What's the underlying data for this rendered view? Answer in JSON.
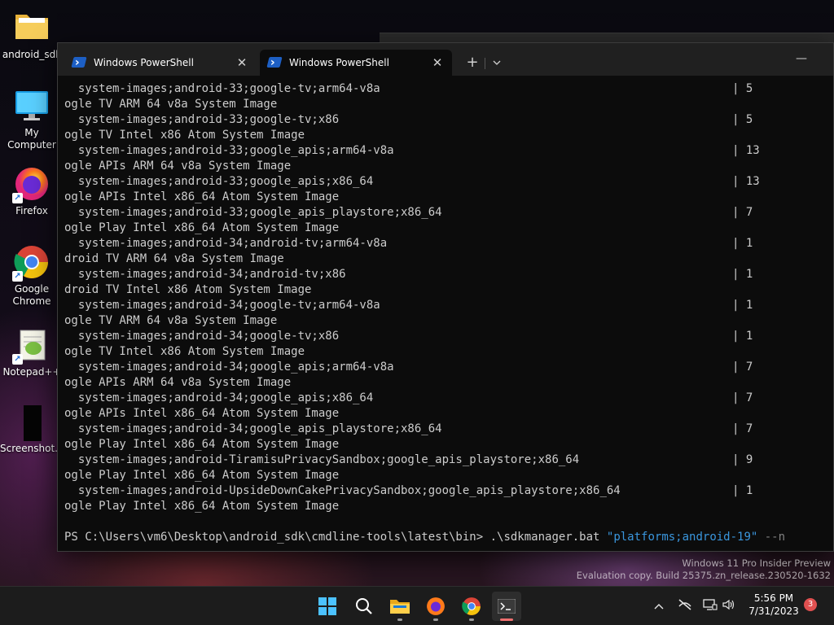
{
  "desktop": {
    "icons": [
      {
        "label": "android_sdk",
        "icon": "folder-icon"
      },
      {
        "label": "My Computer",
        "icon": "monitor-icon"
      },
      {
        "label": "Firefox",
        "icon": "firefox-icon"
      },
      {
        "label": "Google\nChrome",
        "icon": "chrome-icon"
      },
      {
        "label": "Notepad++",
        "icon": "notepadpp-icon"
      },
      {
        "label": "Screenshot...",
        "icon": "screenshot-file-icon"
      }
    ]
  },
  "terminal": {
    "tabs": [
      {
        "label": "Windows PowerShell",
        "icon": "powershell-icon",
        "active": false
      },
      {
        "label": "Windows PowerShell",
        "icon": "powershell-icon",
        "active": true
      }
    ],
    "new_tab": "+",
    "dropdown": "⌄",
    "minimize": "—",
    "rows": [
      {
        "pkg": "  system-images;android-33;google-tv;arm64-v8a",
        "ver": "| 5",
        "desc": "ogle TV ARM 64 v8a System Image"
      },
      {
        "pkg": "  system-images;android-33;google-tv;x86",
        "ver": "| 5",
        "desc": "ogle TV Intel x86 Atom System Image"
      },
      {
        "pkg": "  system-images;android-33;google_apis;arm64-v8a",
        "ver": "| 13",
        "desc": "ogle APIs ARM 64 v8a System Image"
      },
      {
        "pkg": "  system-images;android-33;google_apis;x86_64",
        "ver": "| 13",
        "desc": "ogle APIs Intel x86_64 Atom System Image"
      },
      {
        "pkg": "  system-images;android-33;google_apis_playstore;x86_64",
        "ver": "| 7",
        "desc": "ogle Play Intel x86_64 Atom System Image"
      },
      {
        "pkg": "  system-images;android-34;android-tv;arm64-v8a",
        "ver": "| 1",
        "desc": "droid TV ARM 64 v8a System Image"
      },
      {
        "pkg": "  system-images;android-34;android-tv;x86",
        "ver": "| 1",
        "desc": "droid TV Intel x86 Atom System Image"
      },
      {
        "pkg": "  system-images;android-34;google-tv;arm64-v8a",
        "ver": "| 1",
        "desc": "ogle TV ARM 64 v8a System Image"
      },
      {
        "pkg": "  system-images;android-34;google-tv;x86",
        "ver": "| 1",
        "desc": "ogle TV Intel x86 Atom System Image"
      },
      {
        "pkg": "  system-images;android-34;google_apis;arm64-v8a",
        "ver": "| 7",
        "desc": "ogle APIs ARM 64 v8a System Image"
      },
      {
        "pkg": "  system-images;android-34;google_apis;x86_64",
        "ver": "| 7",
        "desc": "ogle APIs Intel x86_64 Atom System Image"
      },
      {
        "pkg": "  system-images;android-34;google_apis_playstore;x86_64",
        "ver": "| 7",
        "desc": "ogle Play Intel x86_64 Atom System Image"
      },
      {
        "pkg": "  system-images;android-TiramisuPrivacySandbox;google_apis_playstore;x86_64",
        "ver": "| 9",
        "desc": "ogle Play Intel x86_64 Atom System Image"
      },
      {
        "pkg": "  system-images;android-UpsideDownCakePrivacySandbox;google_apis_playstore;x86_64",
        "ver": "| 1",
        "desc": "ogle Play Intel x86_64 Atom System Image"
      }
    ],
    "prompt": {
      "path": "PS C:\\Users\\vm6\\Desktop\\android_sdk\\cmdline-tools\\latest\\bin> ",
      "command": ".\\sdkmanager.bat ",
      "argument": "\"platforms;android-19\"",
      "param": " --n"
    }
  },
  "watermark": {
    "line1": "Windows 11 Pro Insider Preview",
    "line2": "Evaluation copy. Build 25375.zn_release.230520-1632"
  },
  "taskbar": {
    "apps": [
      {
        "name": "start",
        "icon": "windows-start-icon"
      },
      {
        "name": "search",
        "icon": "search-icon"
      },
      {
        "name": "file-explorer",
        "icon": "file-explorer-icon"
      },
      {
        "name": "firefox",
        "icon": "firefox-icon"
      },
      {
        "name": "chrome",
        "icon": "chrome-icon"
      },
      {
        "name": "terminal",
        "icon": "terminal-icon"
      }
    ],
    "time": "5:56 PM",
    "date": "7/31/2023",
    "notifications": "3"
  }
}
